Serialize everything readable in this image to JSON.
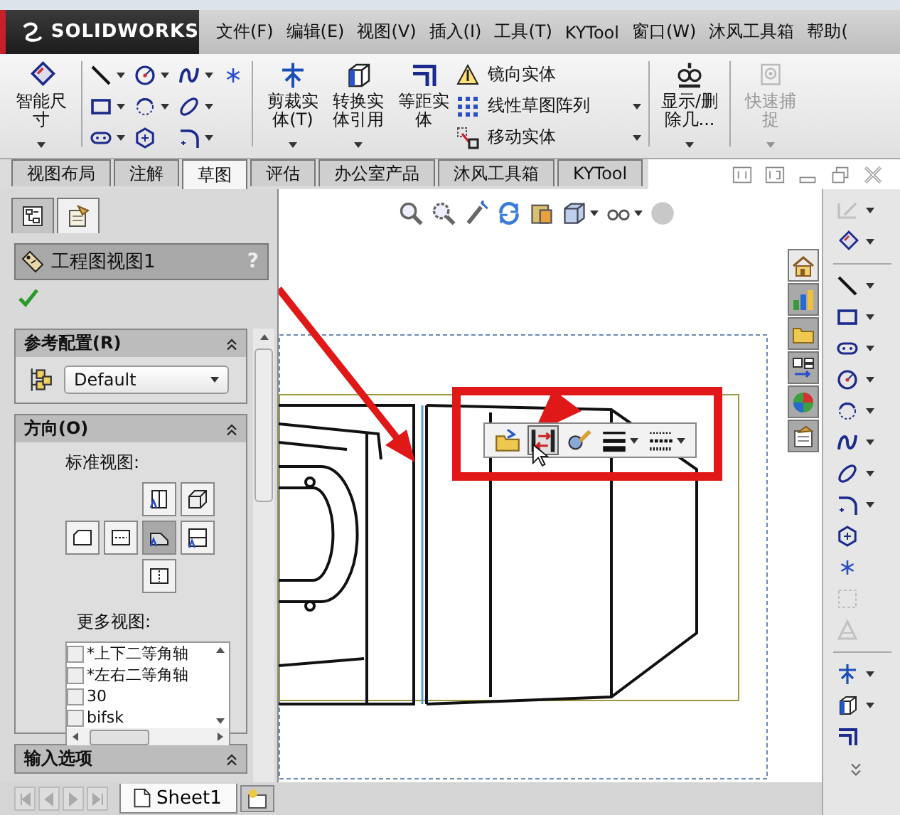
{
  "title_bar": {
    "logo": "SOLIDWORKS",
    "menu": [
      "文件(F)",
      "编辑(E)",
      "视图(V)",
      "插入(I)",
      "工具(T)",
      "KYTool",
      "窗口(W)",
      "沐风工具箱",
      "帮助("
    ]
  },
  "ribbon": {
    "dimension": {
      "label": "智能尺寸",
      "dropdown": true,
      "disabled": false
    },
    "sketch_tools": [
      {
        "dropdown": true
      },
      {
        "dropdown": true
      },
      {
        "dropdown": true
      },
      {
        "dropdown": false
      },
      {
        "dropdown": true
      },
      {
        "dropdown": true
      },
      {
        "dropdown": true
      },
      {
        "dropdown": true
      },
      {
        "dropdown": false
      },
      {
        "dropdown": true
      }
    ],
    "entity_buttons": [
      {
        "label": "剪裁实体(T)",
        "dropdown": true,
        "disabled": false
      },
      {
        "label": "转换实体引用",
        "dropdown": true,
        "disabled": false
      },
      {
        "label": "等距实体",
        "dropdown": false,
        "disabled": false
      }
    ],
    "entity_list": [
      {
        "label": "镜向实体",
        "dropdown": false
      },
      {
        "label": "线性草图阵列",
        "dropdown": true
      },
      {
        "label": "移动实体",
        "dropdown": true
      }
    ],
    "display_buttons": [
      {
        "label": "显示/删除几...",
        "dropdown": true,
        "disabled": false
      },
      {
        "label": "快速捕捉",
        "dropdown": true,
        "disabled": true
      }
    ]
  },
  "tabs": [
    {
      "label": "视图布局",
      "selected": false
    },
    {
      "label": "注解",
      "selected": false
    },
    {
      "label": "草图",
      "selected": true
    },
    {
      "label": "评估",
      "selected": false
    },
    {
      "label": "办公室产品",
      "selected": false
    },
    {
      "label": "沐风工具箱",
      "selected": false
    },
    {
      "label": "KYTool",
      "selected": false
    }
  ],
  "property_manager": {
    "tabs": [
      {
        "selected": false
      },
      {
        "selected": true
      }
    ],
    "title": "工程图视图1",
    "help": "?",
    "reference_config": {
      "title": "参考配置(R)",
      "value": "Default"
    },
    "orientation": {
      "title": "方向(O)",
      "standard_label": "标准视图:",
      "views": [
        {
          "selected": false
        },
        {
          "selected": false
        },
        {
          "selected": false
        },
        {
          "selected": false
        },
        {
          "selected": true
        },
        {
          "selected": false
        },
        {
          "selected": false
        }
      ],
      "more_label": "更多视图:",
      "more_views": [
        {
          "label": "*上下二等角轴",
          "checked": false
        },
        {
          "label": "*左右二等角轴",
          "checked": false
        },
        {
          "label": "30",
          "checked": false
        },
        {
          "label": "bifsk",
          "checked": false
        }
      ]
    },
    "import_options": {
      "title": "输入选项"
    }
  },
  "heads_up_toolbar": [
    {
      "dropdown": false
    },
    {
      "dropdown": false
    },
    {
      "dropdown": false
    },
    {
      "dropdown": false
    },
    {
      "dropdown": false
    },
    {
      "dropdown": true
    },
    {
      "dropdown": true
    },
    {
      "dropdown": false
    }
  ],
  "context_toolbar": [
    {
      "selected": false,
      "dropdown": false
    },
    {
      "selected": true,
      "dropdown": false
    },
    {
      "selected": false,
      "dropdown": false
    },
    {
      "selected": false,
      "dropdown": true
    },
    {
      "selected": false,
      "dropdown": true
    }
  ],
  "task_pane_tabs": [
    {
      "selected": true
    },
    {
      "selected": false
    },
    {
      "selected": false
    },
    {
      "selected": false
    },
    {
      "selected": false
    },
    {
      "selected": false
    }
  ],
  "command_bar": [
    {
      "kind": "tool",
      "disabled": true,
      "dropdown": true
    },
    {
      "kind": "tool",
      "disabled": false,
      "dropdown": true
    },
    {
      "kind": "separator"
    },
    {
      "kind": "tool",
      "disabled": false,
      "dropdown": true
    },
    {
      "kind": "tool",
      "disabled": false,
      "dropdown": true
    },
    {
      "kind": "tool",
      "disabled": false,
      "dropdown": true
    },
    {
      "kind": "tool",
      "disabled": false,
      "dropdown": true
    },
    {
      "kind": "tool",
      "disabled": false,
      "dropdown": true
    },
    {
      "kind": "tool",
      "disabled": false,
      "dropdown": true
    },
    {
      "kind": "tool",
      "disabled": false,
      "dropdown": true
    },
    {
      "kind": "tool",
      "disabled": false,
      "dropdown": true
    },
    {
      "kind": "tool",
      "disabled": false,
      "dropdown": false
    },
    {
      "kind": "tool",
      "disabled": false,
      "dropdown": false
    },
    {
      "kind": "tool",
      "disabled": true,
      "dropdown": false
    },
    {
      "kind": "tool",
      "disabled": true,
      "dropdown": false
    },
    {
      "kind": "separator"
    },
    {
      "kind": "tool",
      "disabled": false,
      "dropdown": true
    },
    {
      "kind": "tool",
      "disabled": false,
      "dropdown": true
    },
    {
      "kind": "tool",
      "disabled": false,
      "dropdown": false
    }
  ],
  "sheet_tabs": [
    {
      "label": "Sheet1",
      "selected": true
    }
  ]
}
